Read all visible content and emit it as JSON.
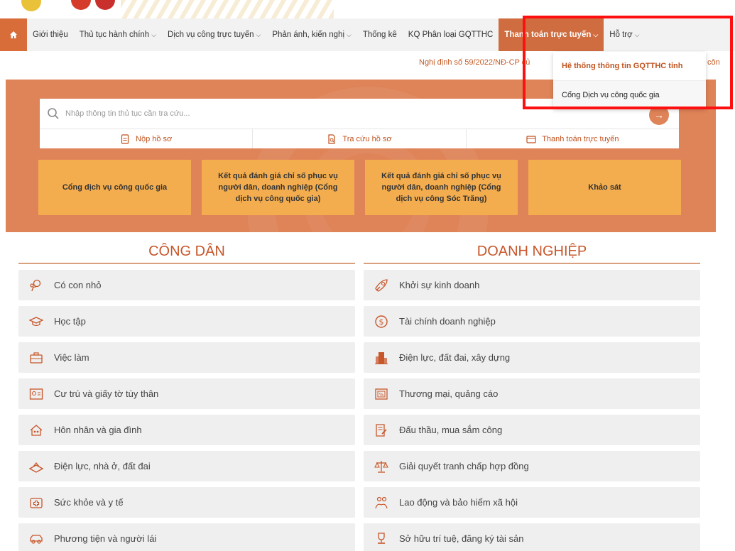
{
  "nav": {
    "home_icon": "home-icon",
    "items": [
      {
        "label": "Giới thiệu",
        "caret": false
      },
      {
        "label": "Thủ tục hành chính",
        "caret": true
      },
      {
        "label": "Dịch vụ công trực tuyến",
        "caret": true
      },
      {
        "label": "Phản ánh, kiến nghị",
        "caret": true
      },
      {
        "label": "Thống kê",
        "caret": false
      },
      {
        "label": "KQ Phân loại GQTTHC",
        "caret": false
      },
      {
        "label": "Thanh toán trực tuyến",
        "caret": true,
        "active": true
      },
      {
        "label": "Hỗ trợ",
        "caret": true
      }
    ]
  },
  "marquee": "Nghị định số 59/2022/NĐ-CP củ",
  "dropdown": {
    "items": [
      "Hệ thống thông tin GQTTHC tỉnh",
      "Cổng Dịch vụ công quốc gia"
    ],
    "tail": "côn"
  },
  "search": {
    "placeholder": "Nhập thông tin thủ tục cần tra cứu..."
  },
  "quick_links": [
    {
      "label": "Nộp hồ sơ",
      "icon": "document-icon"
    },
    {
      "label": "Tra cứu hồ sơ",
      "icon": "search-document-icon"
    },
    {
      "label": "Thanh toán trực tuyến",
      "icon": "credit-card-icon"
    }
  ],
  "cards": [
    "Cổng dịch vụ công quốc gia",
    "Kết quả đánh giá chỉ số phục vụ người dân, doanh nghiệp (Cổng dịch vụ công quốc gia)",
    "Kết quả đánh giá chỉ số phục vụ người dân, doanh nghiệp (Cổng dịch vụ công Sóc Trăng)",
    "Khảo sát"
  ],
  "citizen": {
    "title": "CÔNG DÂN",
    "items": [
      {
        "label": "Có con nhỏ",
        "icon": "baby-icon"
      },
      {
        "label": "Học tập",
        "icon": "graduation-cap-icon"
      },
      {
        "label": "Việc làm",
        "icon": "briefcase-icon"
      },
      {
        "label": "Cư trú và giấy tờ tùy thân",
        "icon": "id-card-icon"
      },
      {
        "label": "Hôn nhân và gia đình",
        "icon": "family-house-icon"
      },
      {
        "label": "Điện lực, nhà ở, đất đai",
        "icon": "land-icon"
      },
      {
        "label": "Sức khỏe và y tế",
        "icon": "medical-icon"
      },
      {
        "label": "Phương tiện và người lái",
        "icon": "car-icon"
      }
    ]
  },
  "business": {
    "title": "DOANH NGHIỆP",
    "items": [
      {
        "label": "Khởi sự kinh doanh",
        "icon": "rocket-icon"
      },
      {
        "label": "Tài chính doanh nghiệp",
        "icon": "dollar-icon"
      },
      {
        "label": "Điện lực, đất đai, xây dựng",
        "icon": "building-icon"
      },
      {
        "label": "Thương mại, quảng cáo",
        "icon": "percent-tag-icon"
      },
      {
        "label": "Đấu thầu, mua sắm công",
        "icon": "document-edit-icon"
      },
      {
        "label": "Giải quyết tranh chấp hợp đồng",
        "icon": "scales-icon"
      },
      {
        "label": "Lao động và bảo hiểm xã hội",
        "icon": "worker-icon"
      },
      {
        "label": "Sở hữu trí tuệ, đăng ký tài sản",
        "icon": "trophy-icon"
      }
    ]
  },
  "colors": {
    "accent": "#cf6d40",
    "hero": "#df8358",
    "card": "#f4ad4e",
    "highlight": "#ff1010"
  }
}
